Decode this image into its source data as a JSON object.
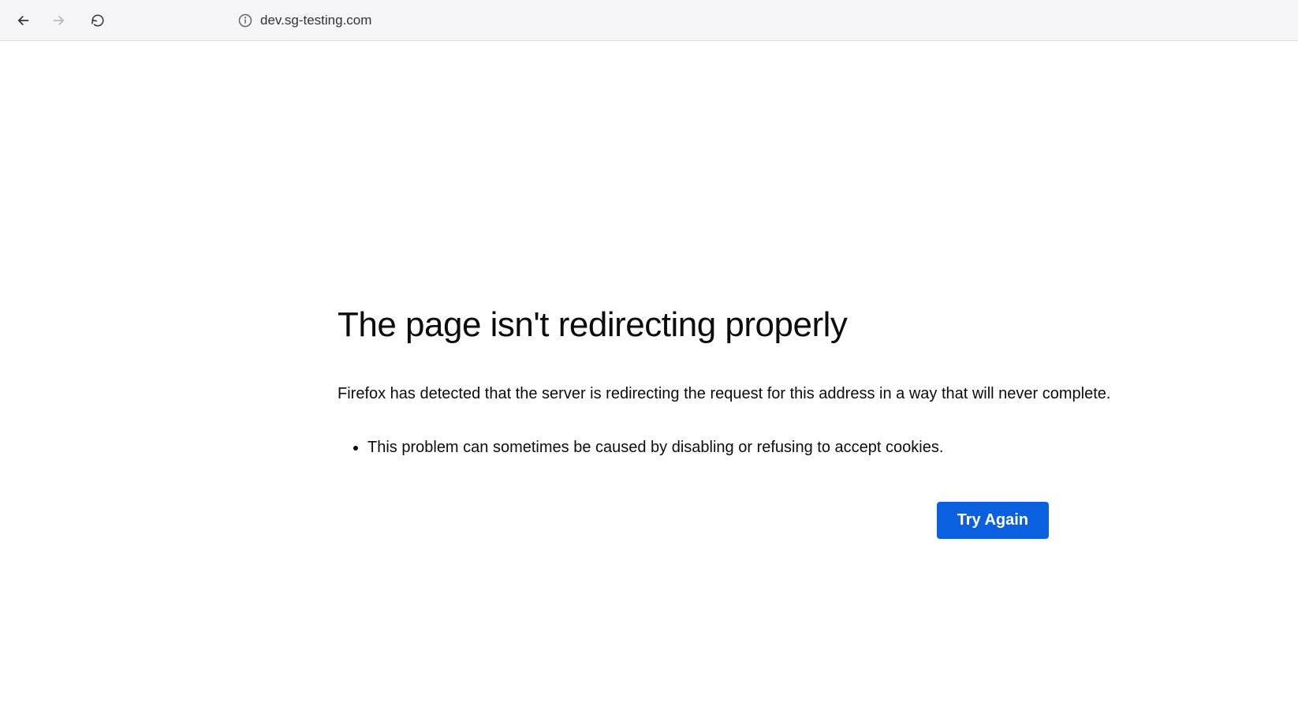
{
  "toolbar": {
    "url": "dev.sg-testing.com"
  },
  "error": {
    "title": "The page isn't redirecting properly",
    "description": "Firefox has detected that the server is redirecting the request for this address in a way that will never complete.",
    "bullet": "This problem can sometimes be caused by disabling or refusing to accept cookies.",
    "tryAgainLabel": "Try Again"
  }
}
